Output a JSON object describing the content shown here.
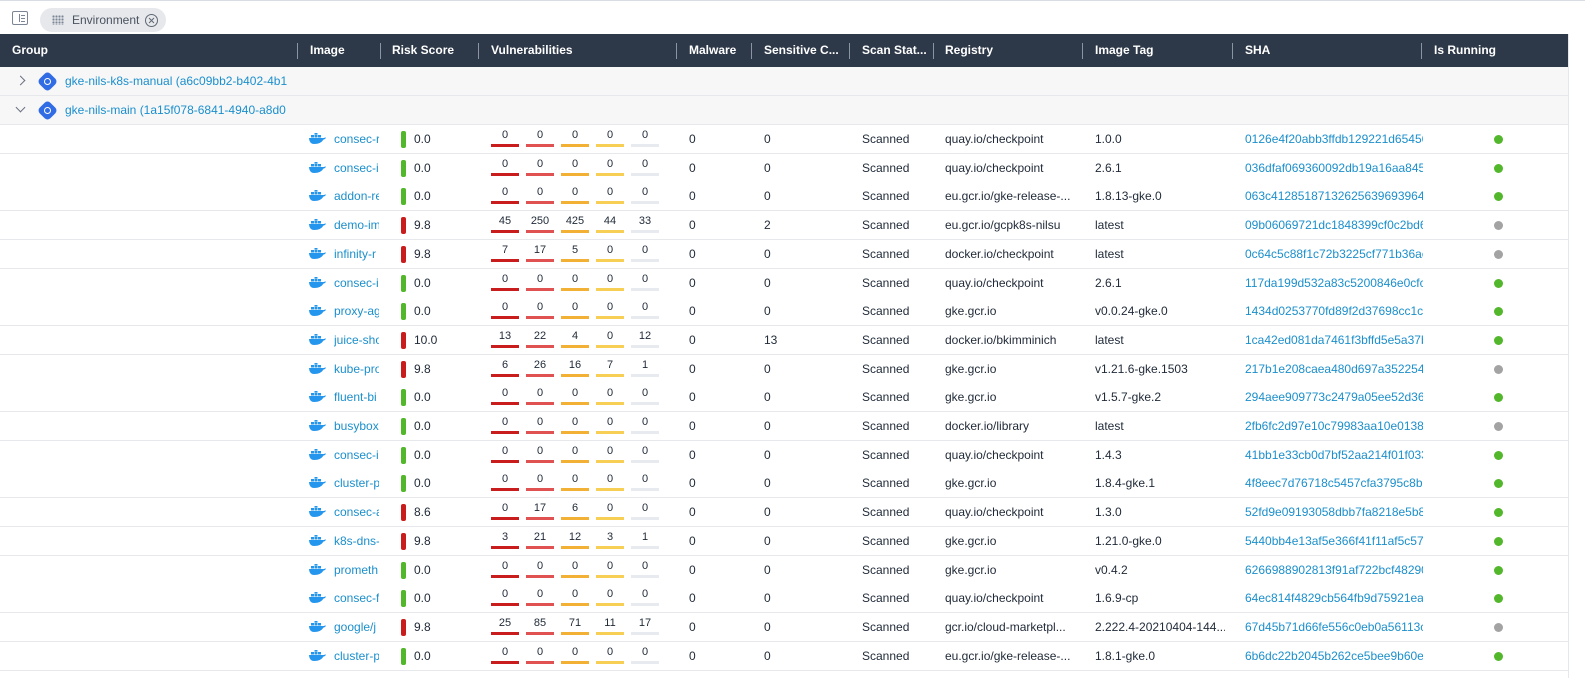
{
  "toolbar": {
    "filter_chip_label": "Environment"
  },
  "table": {
    "columns": [
      "Group",
      "Image",
      "Risk Score",
      "Vulnerabilities",
      "Malware",
      "Sensitive C...",
      "Scan Stat...",
      "Registry",
      "Image Tag",
      "SHA",
      "Is Running"
    ],
    "groups": [
      {
        "label": "gke-nils-k8s-manual (a6c09bb2-b402-4b1",
        "expanded": false
      },
      {
        "label": "gke-nils-main (1a15f078-6841-4940-a8d0",
        "expanded": true
      }
    ],
    "rows": [
      {
        "image": "consec-r",
        "risk": "0.0",
        "risk_level": "low",
        "vulns": [
          "0",
          "0",
          "0",
          "0",
          "0"
        ],
        "malware": "0",
        "sensitive": "0",
        "scan": "Scanned",
        "registry": "quay.io/checkpoint",
        "tag": "1.0.0",
        "sha": "0126e4f20abb3ffdb129221d65456",
        "running": true
      },
      {
        "image": "consec-i",
        "risk": "0.0",
        "risk_level": "low",
        "vulns": [
          "0",
          "0",
          "0",
          "0",
          "0"
        ],
        "malware": "0",
        "sensitive": "0",
        "scan": "Scanned",
        "registry": "quay.io/checkpoint",
        "tag": "2.6.1",
        "sha": "036dfaf069360092db19a16aa8454",
        "running": true
      },
      {
        "image": "addon-re",
        "risk": "0.0",
        "risk_level": "low",
        "vulns": [
          "0",
          "0",
          "0",
          "0",
          "0"
        ],
        "malware": "0",
        "sensitive": "0",
        "scan": "Scanned",
        "registry": "eu.gcr.io/gke-release-...",
        "tag": "1.8.13-gke.0",
        "sha": "063c4128518713262563969396477",
        "running": true
      },
      {
        "image": "demo-im",
        "risk": "9.8",
        "risk_level": "high",
        "vulns": [
          "45",
          "250",
          "425",
          "44",
          "33"
        ],
        "malware": "0",
        "sensitive": "2",
        "scan": "Scanned",
        "registry": "eu.gcr.io/gcpk8s-nilsu",
        "tag": "latest",
        "sha": "09b06069721dc1848399cf0c2bd6",
        "running": false
      },
      {
        "image": "infinity-r",
        "risk": "9.8",
        "risk_level": "high",
        "vulns": [
          "7",
          "17",
          "5",
          "0",
          "0"
        ],
        "malware": "0",
        "sensitive": "0",
        "scan": "Scanned",
        "registry": "docker.io/checkpoint",
        "tag": "latest",
        "sha": "0c64c5c88f1c72b3225cf771b36ae",
        "running": false
      },
      {
        "image": "consec-i",
        "risk": "0.0",
        "risk_level": "low",
        "vulns": [
          "0",
          "0",
          "0",
          "0",
          "0"
        ],
        "malware": "0",
        "sensitive": "0",
        "scan": "Scanned",
        "registry": "quay.io/checkpoint",
        "tag": "2.6.1",
        "sha": "117da199d532a83c5200846e0cfcc",
        "running": true
      },
      {
        "image": "proxy-ag",
        "risk": "0.0",
        "risk_level": "low",
        "vulns": [
          "0",
          "0",
          "0",
          "0",
          "0"
        ],
        "malware": "0",
        "sensitive": "0",
        "scan": "Scanned",
        "registry": "gke.gcr.io",
        "tag": "v0.0.24-gke.0",
        "sha": "1434d0253770fd89f2d37698cc1cb",
        "running": true
      },
      {
        "image": "juice-sho",
        "risk": "10.0",
        "risk_level": "high",
        "vulns": [
          "13",
          "22",
          "4",
          "0",
          "12"
        ],
        "malware": "0",
        "sensitive": "13",
        "scan": "Scanned",
        "registry": "docker.io/bkimminich",
        "tag": "latest",
        "sha": "1ca42ed081da7461f3bffd5e5a37b",
        "running": true
      },
      {
        "image": "kube-pro",
        "risk": "9.8",
        "risk_level": "high",
        "vulns": [
          "6",
          "26",
          "16",
          "7",
          "1"
        ],
        "malware": "0",
        "sensitive": "0",
        "scan": "Scanned",
        "registry": "gke.gcr.io",
        "tag": "v1.21.6-gke.1503",
        "sha": "217b1e208caea480d697a3522548",
        "running": false
      },
      {
        "image": "fluent-bi",
        "risk": "0.0",
        "risk_level": "low",
        "vulns": [
          "0",
          "0",
          "0",
          "0",
          "0"
        ],
        "malware": "0",
        "sensitive": "0",
        "scan": "Scanned",
        "registry": "gke.gcr.io",
        "tag": "v1.5.7-gke.2",
        "sha": "294aee909773c2479a05ee52d363",
        "running": true
      },
      {
        "image": "busybox",
        "risk": "0.0",
        "risk_level": "low",
        "vulns": [
          "0",
          "0",
          "0",
          "0",
          "0"
        ],
        "malware": "0",
        "sensitive": "0",
        "scan": "Scanned",
        "registry": "docker.io/library",
        "tag": "latest",
        "sha": "2fb6fc2d97e10c79983aa10e01382",
        "running": false
      },
      {
        "image": "consec-i",
        "risk": "0.0",
        "risk_level": "low",
        "vulns": [
          "0",
          "0",
          "0",
          "0",
          "0"
        ],
        "malware": "0",
        "sensitive": "0",
        "scan": "Scanned",
        "registry": "quay.io/checkpoint",
        "tag": "1.4.3",
        "sha": "41bb1e33cb0d7bf52aa214f01f033",
        "running": true
      },
      {
        "image": "cluster-p",
        "risk": "0.0",
        "risk_level": "low",
        "vulns": [
          "0",
          "0",
          "0",
          "0",
          "0"
        ],
        "malware": "0",
        "sensitive": "0",
        "scan": "Scanned",
        "registry": "gke.gcr.io",
        "tag": "1.8.4-gke.1",
        "sha": "4f8eec7d76718c5457cfa3795c8b2",
        "running": true
      },
      {
        "image": "consec-a",
        "risk": "8.6",
        "risk_level": "high",
        "vulns": [
          "0",
          "17",
          "6",
          "0",
          "0"
        ],
        "malware": "0",
        "sensitive": "0",
        "scan": "Scanned",
        "registry": "quay.io/checkpoint",
        "tag": "1.3.0",
        "sha": "52fd9e09193058dbb7fa8218e5b8",
        "running": true
      },
      {
        "image": "k8s-dns-",
        "risk": "9.8",
        "risk_level": "high",
        "vulns": [
          "3",
          "21",
          "12",
          "3",
          "1"
        ],
        "malware": "0",
        "sensitive": "0",
        "scan": "Scanned",
        "registry": "gke.gcr.io",
        "tag": "1.21.0-gke.0",
        "sha": "5440bb4e13af5e366f41f11af5c57",
        "running": true
      },
      {
        "image": "prometh",
        "risk": "0.0",
        "risk_level": "low",
        "vulns": [
          "0",
          "0",
          "0",
          "0",
          "0"
        ],
        "malware": "0",
        "sensitive": "0",
        "scan": "Scanned",
        "registry": "gke.gcr.io",
        "tag": "v0.4.2",
        "sha": "6266988902813f91af722bcf48290",
        "running": true
      },
      {
        "image": "consec-f",
        "risk": "0.0",
        "risk_level": "low",
        "vulns": [
          "0",
          "0",
          "0",
          "0",
          "0"
        ],
        "malware": "0",
        "sensitive": "0",
        "scan": "Scanned",
        "registry": "quay.io/checkpoint",
        "tag": "1.6.9-cp",
        "sha": "64ec814f4829cb564fb9d75921eaf",
        "running": true
      },
      {
        "image": "google/j",
        "risk": "9.8",
        "risk_level": "high",
        "vulns": [
          "25",
          "85",
          "71",
          "11",
          "17"
        ],
        "malware": "0",
        "sensitive": "0",
        "scan": "Scanned",
        "registry": "gcr.io/cloud-marketpl...",
        "tag": "2.222.4-20210404-144...",
        "sha": "67d45b71d66fe556c0eb0a56113c",
        "running": false
      },
      {
        "image": "cluster-p",
        "risk": "0.0",
        "risk_level": "low",
        "vulns": [
          "0",
          "0",
          "0",
          "0",
          "0"
        ],
        "malware": "0",
        "sensitive": "0",
        "scan": "Scanned",
        "registry": "eu.gcr.io/gke-release-...",
        "tag": "1.8.1-gke.0",
        "sha": "6b6dc22b2045b262ce5bee9b60e9",
        "running": true
      }
    ]
  },
  "colors": {
    "header_bg": "#2d3848",
    "link": "#1b8fcc",
    "risk_low": "#52b72a",
    "risk_high": "#c91d1d",
    "running_on": "#52b72a",
    "running_off": "#a3a3a3",
    "docker_blue": "#2496ed"
  },
  "icons": {
    "panel_toggle": "sidebar-toggle-icon",
    "chip_drag": "drag-handle-icon",
    "chip_close": "close-circle-icon",
    "group": "kubernetes-icon",
    "image": "docker-whale-icon",
    "expand": "chevron-right-icon",
    "collapse": "chevron-down-icon"
  }
}
